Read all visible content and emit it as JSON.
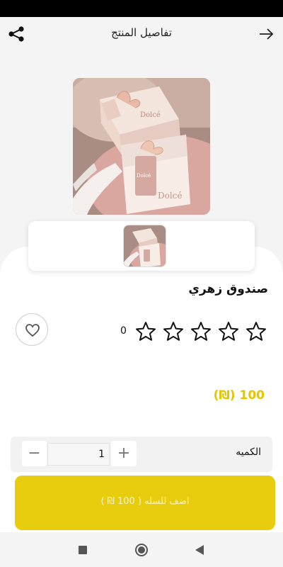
{
  "header": {
    "title": "تفاصيل المنتج",
    "share_icon": "share-icon",
    "back_icon": "arrow-right-icon"
  },
  "product": {
    "name": "صندوق زهري",
    "rating_count": "0",
    "stars_total": 5,
    "rating_value": 0,
    "price": "100 (₪)",
    "favorite_icon": "heart-outline-icon"
  },
  "quantity": {
    "label": "الكميه",
    "value": "1",
    "minus": "−",
    "plus": "+"
  },
  "cart_button": {
    "label": "اضف للسله ( 100 ₪ )"
  },
  "colors": {
    "accent": "#e8cc0e",
    "price": "#e5c400",
    "background": "#f4f4f4"
  },
  "nav": {
    "recent_icon": "square-icon",
    "home_icon": "circle-home-icon",
    "back_icon": "triangle-back-icon"
  }
}
